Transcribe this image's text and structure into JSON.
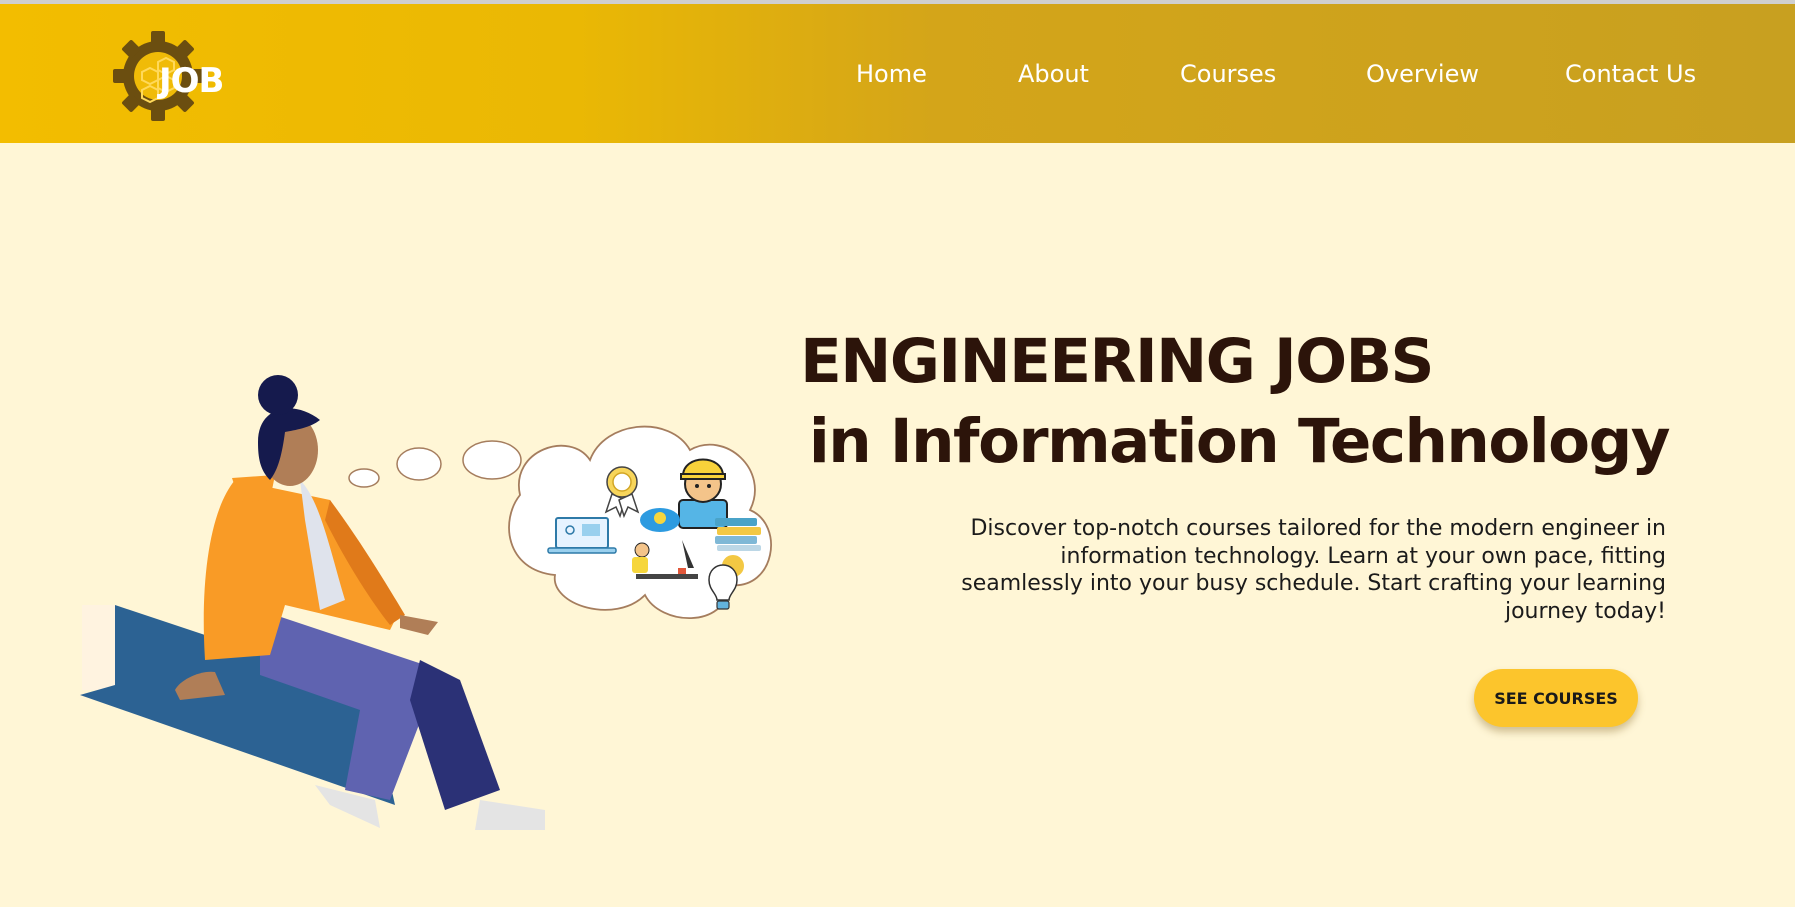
{
  "header": {
    "logo_text": "JOB",
    "nav": [
      {
        "label": "Home"
      },
      {
        "label": "About"
      },
      {
        "label": "Courses"
      },
      {
        "label": "Overview"
      },
      {
        "label": "Contact Us"
      }
    ]
  },
  "hero": {
    "title_line1": "ENGINEERING JOBS",
    "title_line2": "in Information Technology",
    "description": "Discover top-notch courses tailored for the modern engineer in information technology. Learn at your own pace, fitting seamlessly into your busy schedule. Start crafting your learning journey today!",
    "cta_label": "SEE COURSES"
  },
  "colors": {
    "header_start": "#f3bd00",
    "header_end": "#c8a020",
    "background": "#fff6d6",
    "title": "#2c140a",
    "cta": "#fcc52c"
  },
  "icons": [
    "gear-logo-icon",
    "badge-icon",
    "engineer-icon",
    "laptop-icon",
    "idea-person-icon",
    "books-icon",
    "lightbulb-icon"
  ]
}
